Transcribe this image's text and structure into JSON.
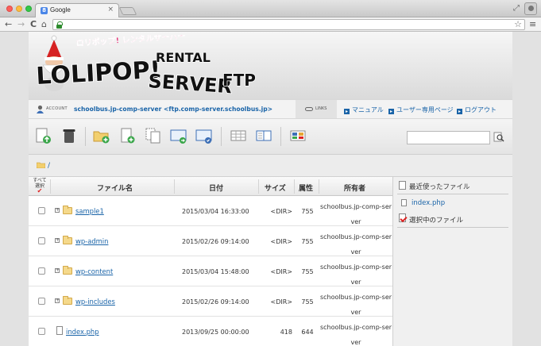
{
  "browser": {
    "tab_title": "Google",
    "tab_close": "×",
    "back": "←",
    "forward": "→",
    "reload": "C",
    "home": "⌂",
    "star": "☆",
    "menu": "≡",
    "fullscreen": "⤢"
  },
  "logo": {
    "tagline": "ロリポップ! レンタルサーバー",
    "word1": "LOLIPOP!",
    "word2": "RENTAL",
    "word3": "SERVER",
    "word4": "FTP"
  },
  "infobar": {
    "account_label": "ACCOUNT",
    "account_value": "schoolbus.jp-comp-server <ftp.comp-server.schoolbus.jp>",
    "links_label": "LINKS",
    "nav": [
      {
        "label": "マニュアル"
      },
      {
        "label": "ユーザー専用ページ"
      },
      {
        "label": "ログアウト"
      }
    ]
  },
  "path": {
    "current": "/"
  },
  "table": {
    "select_all_line1": "すべて",
    "select_all_line2": "選択",
    "headers": {
      "name": "ファイル名",
      "date": "日付",
      "size": "サイズ",
      "attr": "属性",
      "owner": "所有者"
    },
    "rows": [
      {
        "type": "dir",
        "name": "sample1",
        "date": "2015/03/04 16:33:00",
        "size": "<DIR>",
        "attr": "755",
        "owner": "schoolbus.jp-comp-server"
      },
      {
        "type": "dir",
        "name": "wp-admin",
        "date": "2015/02/26 09:14:00",
        "size": "<DIR>",
        "attr": "755",
        "owner": "schoolbus.jp-comp-server"
      },
      {
        "type": "dir",
        "name": "wp-content",
        "date": "2015/03/04 15:48:00",
        "size": "<DIR>",
        "attr": "755",
        "owner": "schoolbus.jp-comp-server"
      },
      {
        "type": "dir",
        "name": "wp-includes",
        "date": "2015/02/26 09:14:00",
        "size": "<DIR>",
        "attr": "755",
        "owner": "schoolbus.jp-comp-server"
      },
      {
        "type": "file",
        "name": "index.php",
        "date": "2013/09/25 00:00:00",
        "size": "418",
        "attr": "644",
        "owner": "schoolbus.jp-comp-server"
      }
    ]
  },
  "sidepanel": {
    "recent_label": "最近使ったファイル",
    "recent_items": [
      "index.php"
    ],
    "selected_label": "選択中のファイル"
  },
  "colors": {
    "link": "#1a64a8",
    "accent_red": "#dd2222"
  }
}
